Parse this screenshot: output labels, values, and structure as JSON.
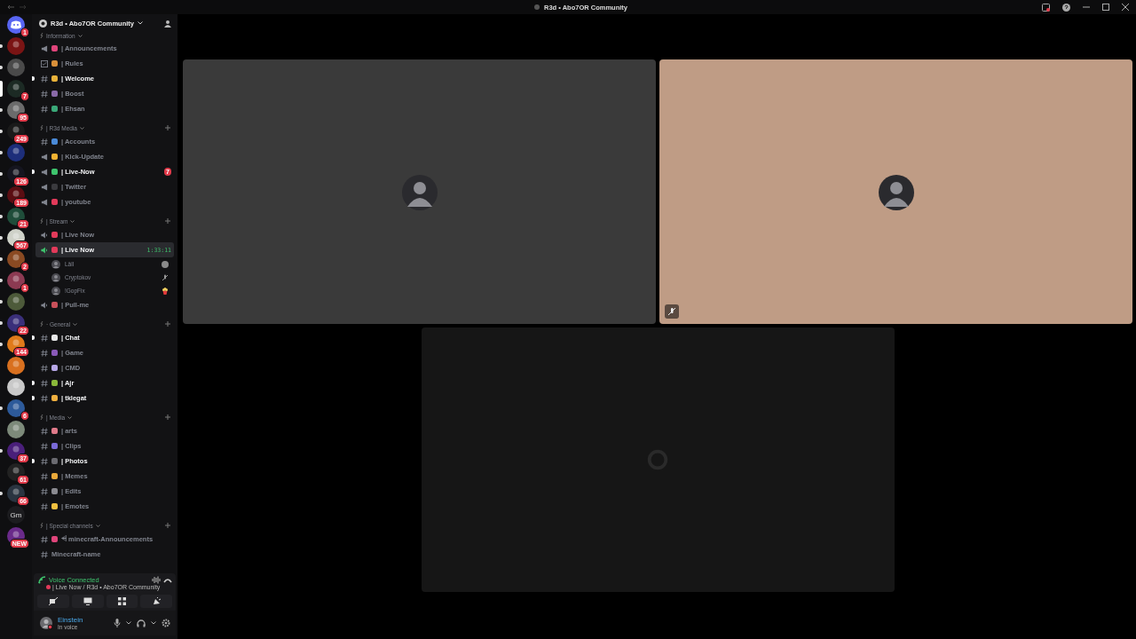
{
  "title_bar": {
    "title": "R3d • Abo7OR Community"
  },
  "servers": [
    {
      "kind": "home",
      "badge": "1",
      "unread": false,
      "selected": false,
      "color": "#5865f2"
    },
    {
      "kind": "server",
      "unread": true,
      "selected": false,
      "color": "#7a1414"
    },
    {
      "kind": "server",
      "unread": true,
      "selected": false,
      "color": "#4a4a4a"
    },
    {
      "kind": "server",
      "badge": "7",
      "unread": false,
      "selected": true,
      "color": "#1c2a24"
    },
    {
      "kind": "server",
      "badge": "95",
      "unread": true,
      "selected": false,
      "color": "#6b6b6b"
    },
    {
      "kind": "server",
      "badge": "249",
      "unread": true,
      "selected": false,
      "color": "#1a1a1a"
    },
    {
      "kind": "server",
      "unread": true,
      "selected": false,
      "color": "#1d2e7a"
    },
    {
      "kind": "server",
      "badge": "126",
      "unread": true,
      "selected": false,
      "color": "#15151f"
    },
    {
      "kind": "server",
      "badge": "189",
      "unread": true,
      "selected": false,
      "color": "#5a0d12"
    },
    {
      "kind": "server",
      "badge": "21",
      "unread": true,
      "selected": false,
      "color": "#1f4d3a"
    },
    {
      "kind": "server",
      "badge": "567",
      "unread": true,
      "selected": false,
      "color": "#cfd2c9"
    },
    {
      "kind": "server",
      "badge": "2",
      "unread": true,
      "selected": false,
      "color": "#8a4a22"
    },
    {
      "kind": "server",
      "badge": "1",
      "unread": true,
      "selected": false,
      "color": "#8c3a52"
    },
    {
      "kind": "server",
      "unread": true,
      "selected": false,
      "color": "#4d5a3a"
    },
    {
      "kind": "server",
      "badge": "22",
      "unread": true,
      "selected": false,
      "color": "#3a2f7a"
    },
    {
      "kind": "server",
      "badge": "144",
      "unread": true,
      "selected": false,
      "color": "#e07a1a"
    },
    {
      "kind": "server",
      "unread": false,
      "selected": false,
      "color": "#d9701f"
    },
    {
      "kind": "server",
      "unread": false,
      "selected": false,
      "color": "#c9c9c9"
    },
    {
      "kind": "server",
      "badge": "6",
      "unread": true,
      "selected": false,
      "color": "#2d5a9a"
    },
    {
      "kind": "server",
      "unread": false,
      "selected": false,
      "color": "#7d8a7a"
    },
    {
      "kind": "server",
      "badge": "37",
      "unread": true,
      "selected": false,
      "color": "#4a1f7a"
    },
    {
      "kind": "server",
      "badge": "61",
      "unread": false,
      "selected": false,
      "color": "#222222"
    },
    {
      "kind": "server",
      "badge": "66",
      "unread": true,
      "selected": false,
      "color": "#2a3440"
    },
    {
      "kind": "initials",
      "label": "Gm",
      "unread": false,
      "selected": false,
      "color": "#1c1c1f"
    },
    {
      "kind": "server",
      "badge": "NEW",
      "unread": false,
      "selected": false,
      "color": "#6a2a8a"
    }
  ],
  "server_header": {
    "name": "R3d • Abo7OR Community"
  },
  "categories": [
    {
      "name": "Information",
      "items": [
        {
          "kind": "announcement",
          "color": "#e0457b",
          "name": "| Announcements",
          "unread": false,
          "selected": false
        },
        {
          "kind": "rules",
          "color": "#d9903a",
          "name": "| Rules",
          "unread": false,
          "selected": false
        },
        {
          "kind": "text",
          "color": "#e8b23a",
          "name": "| Welcome",
          "unread": true,
          "selected": false
        },
        {
          "kind": "text",
          "color": "#8a6aa8",
          "name": "| Boost",
          "unread": false,
          "selected": false
        },
        {
          "kind": "text",
          "color": "#3aa878",
          "name": "| Ehsan",
          "unread": false,
          "selected": false
        }
      ]
    },
    {
      "name": "| R3d Media",
      "items": [
        {
          "kind": "text",
          "color": "#4a8ad8",
          "name": "| Accounts",
          "unread": false,
          "selected": false
        },
        {
          "kind": "announcement",
          "color": "#f0b232",
          "name": "| Kick-Update",
          "unread": false,
          "selected": false
        },
        {
          "kind": "announcement",
          "color": "#3ec46d",
          "name": "| Live-Now",
          "unread": true,
          "selected": false,
          "badge": "7"
        },
        {
          "kind": "announcement",
          "color": "#3a3a3e",
          "name": "| Twitter",
          "unread": false,
          "selected": false
        },
        {
          "kind": "announcement",
          "color": "#e23a5a",
          "name": "| youtube",
          "unread": false,
          "selected": false
        }
      ]
    },
    {
      "name": "| Stream",
      "items": [
        {
          "kind": "voice",
          "color": "#e23a5a",
          "name": "| Live Now",
          "unread": false,
          "selected": false
        },
        {
          "kind": "voice",
          "color": "#e23a5a",
          "name": "| Live Now",
          "unread": false,
          "selected": true,
          "timer": "1:33:11",
          "members": [
            {
              "name": "Lâll",
              "kind": "deafened"
            },
            {
              "name": "Cryptokov",
              "kind": "muted"
            },
            {
              "name": "!GopFix",
              "kind": "emoji"
            }
          ]
        },
        {
          "kind": "voice",
          "color": "#c8505a",
          "name": "| Pull-me",
          "unread": false,
          "selected": false
        }
      ]
    },
    {
      "name": "· General",
      "items": [
        {
          "kind": "text",
          "color": "#e8e8e8",
          "name": "| Chat",
          "unread": true,
          "selected": false
        },
        {
          "kind": "text",
          "color": "#8a5ab8",
          "name": "| Game",
          "unread": false,
          "selected": false
        },
        {
          "kind": "text",
          "color": "#b8a8e8",
          "name": "| CMD",
          "unread": false,
          "selected": false
        },
        {
          "kind": "text",
          "color": "#8ab83a",
          "name": "| Ajr",
          "unread": true,
          "selected": false
        },
        {
          "kind": "text",
          "color": "#f0b040",
          "name": "| tklegat",
          "unread": true,
          "selected": false
        }
      ]
    },
    {
      "name": "| Media",
      "items": [
        {
          "kind": "text",
          "color": "#e07a8a",
          "name": "| arts",
          "unread": false,
          "selected": false
        },
        {
          "kind": "text",
          "color": "#7a6ad8",
          "name": "| Clips",
          "unread": false,
          "selected": false
        },
        {
          "kind": "text",
          "color": "#6a6a70",
          "name": "| Photos",
          "unread": true,
          "selected": false
        },
        {
          "kind": "text",
          "color": "#e8a83a",
          "name": "| Memes",
          "unread": false,
          "selected": false
        },
        {
          "kind": "text",
          "color": "#8a8a90",
          "name": "| Edits",
          "unread": false,
          "selected": false
        },
        {
          "kind": "text",
          "color": "#f0c040",
          "name": "| Emotes",
          "unread": false,
          "selected": false
        }
      ]
    },
    {
      "name": "| Special channels",
      "items": [
        {
          "kind": "text",
          "color": "#e0457b",
          "name": "⩤ minecraft-Announcements",
          "unread": false,
          "selected": false
        },
        {
          "kind": "text",
          "name": "Minecraft-name",
          "unread": false,
          "selected": false
        }
      ]
    }
  ],
  "voice_panel": {
    "status": "Voice Connected",
    "location": "| Live Now / R3d • Abo7OR Community"
  },
  "user_panel": {
    "name": "Einstein",
    "status": "In voice"
  },
  "tiles": [
    {
      "kind": "avatar",
      "muted": false,
      "color": "#3a3a3a"
    },
    {
      "kind": "avatar",
      "muted": true,
      "color": "#bf9c85"
    },
    {
      "kind": "logo",
      "muted": false,
      "color": "#161616"
    }
  ]
}
